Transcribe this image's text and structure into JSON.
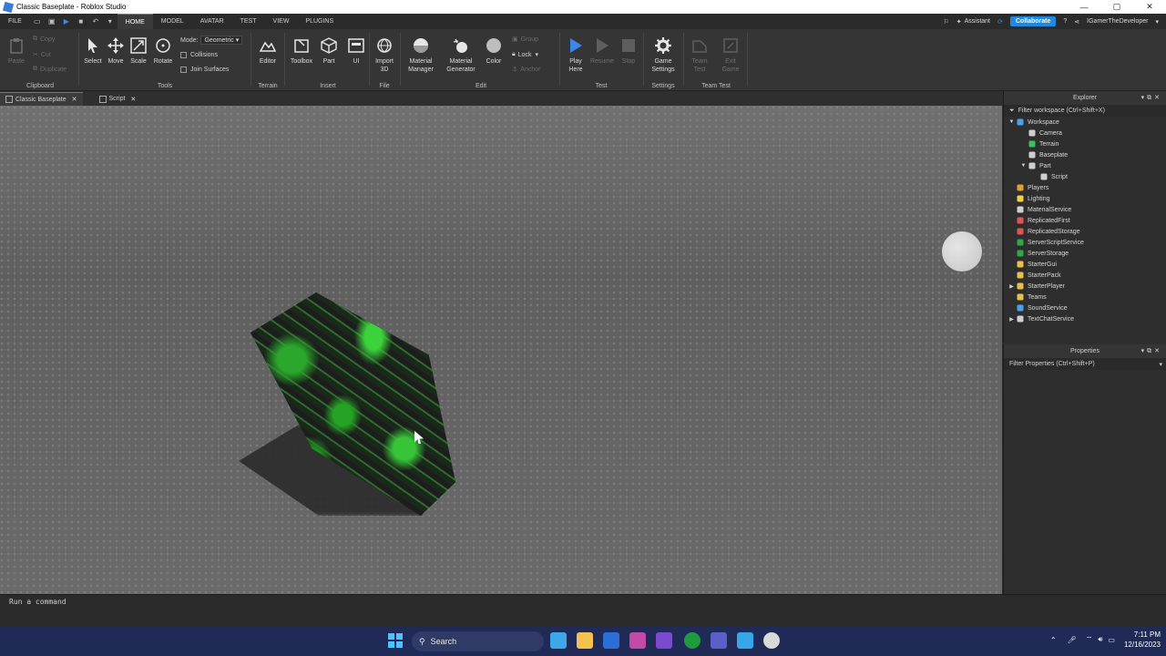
{
  "window": {
    "title": "Classic Baseplate - Roblox Studio"
  },
  "menu": {
    "file": "FILE",
    "tabs": [
      "HOME",
      "MODEL",
      "AVATAR",
      "TEST",
      "VIEW",
      "PLUGINS"
    ],
    "assistant": "Assistant",
    "collaborate": "Collaborate",
    "user": "IGamerTheDeveloper"
  },
  "ribbon": {
    "clipboard": {
      "paste": "Paste",
      "copy": "Copy",
      "cut": "Cut",
      "duplicate": "Duplicate",
      "label": "Clipboard"
    },
    "tools": {
      "select": "Select",
      "move": "Move",
      "scale": "Scale",
      "rotate": "Rotate",
      "mode_label": "Mode:",
      "mode_value": "Geometric",
      "collisions": "Collisions",
      "join_surfaces": "Join Surfaces",
      "label": "Tools"
    },
    "terrain": {
      "editor": "Editor",
      "label": "Terrain"
    },
    "insert": {
      "toolbox": "Toolbox",
      "part": "Part",
      "ui": "UI",
      "label": "Insert"
    },
    "file": {
      "import3d_1": "Import",
      "import3d_2": "3D",
      "label": "File"
    },
    "edit": {
      "material_manager_1": "Material",
      "material_manager_2": "Manager",
      "material_generator_1": "Material",
      "material_generator_2": "Generator",
      "color": "Color",
      "group": "Group",
      "lock": "Lock",
      "anchor": "Anchor",
      "label": "Edit"
    },
    "test": {
      "play_here_1": "Play",
      "play_here_2": "Here",
      "resume": "Resume",
      "stop": "Stop",
      "label": "Test"
    },
    "settings": {
      "game_settings_1": "Game",
      "game_settings_2": "Settings",
      "label": "Settings"
    },
    "team_test": {
      "team_test_1": "Team",
      "team_test_2": "Test",
      "exit_game_1": "Exit",
      "exit_game_2": "Game",
      "label": "Team Test"
    }
  },
  "doc_tabs": [
    "Classic Baseplate",
    "Script"
  ],
  "explorer": {
    "title": "Explorer",
    "filter": "Filter workspace (Ctrl+Shift+X)",
    "items": [
      {
        "label": "Workspace",
        "icon": "globe-icon",
        "indent": 0,
        "arrow": "▼"
      },
      {
        "label": "Camera",
        "icon": "camera-icon",
        "indent": 1,
        "arrow": ""
      },
      {
        "label": "Terrain",
        "icon": "terrain-icon",
        "indent": 1,
        "arrow": ""
      },
      {
        "label": "Baseplate",
        "icon": "part-icon",
        "indent": 1,
        "arrow": ""
      },
      {
        "label": "Part",
        "icon": "part-icon",
        "indent": 1,
        "arrow": "▼"
      },
      {
        "label": "Script",
        "icon": "script-icon",
        "indent": 2,
        "arrow": ""
      },
      {
        "label": "Players",
        "icon": "players-icon",
        "indent": 0,
        "arrow": ""
      },
      {
        "label": "Lighting",
        "icon": "lighting-icon",
        "indent": 0,
        "arrow": ""
      },
      {
        "label": "MaterialService",
        "icon": "material-icon",
        "indent": 0,
        "arrow": ""
      },
      {
        "label": "ReplicatedFirst",
        "icon": "replicated-icon",
        "indent": 0,
        "arrow": ""
      },
      {
        "label": "ReplicatedStorage",
        "icon": "replicated-icon",
        "indent": 0,
        "arrow": ""
      },
      {
        "label": "ServerScriptService",
        "icon": "server-icon",
        "indent": 0,
        "arrow": ""
      },
      {
        "label": "ServerStorage",
        "icon": "server-icon",
        "indent": 0,
        "arrow": ""
      },
      {
        "label": "StarterGui",
        "icon": "folder-icon",
        "indent": 0,
        "arrow": ""
      },
      {
        "label": "StarterPack",
        "icon": "folder-icon",
        "indent": 0,
        "arrow": ""
      },
      {
        "label": "StarterPlayer",
        "icon": "folder-icon",
        "indent": 0,
        "arrow": "▶"
      },
      {
        "label": "Teams",
        "icon": "folder-icon",
        "indent": 0,
        "arrow": ""
      },
      {
        "label": "SoundService",
        "icon": "sound-icon",
        "indent": 0,
        "arrow": ""
      },
      {
        "label": "TextChatService",
        "icon": "chat-icon",
        "indent": 0,
        "arrow": "▶"
      }
    ]
  },
  "properties": {
    "title": "Properties",
    "filter": "Filter Properties (Ctrl+Shift+P)"
  },
  "command_bar": {
    "text": "Run a command"
  },
  "taskbar": {
    "search": "Search",
    "time": "7:11 PM",
    "date": "12/16/2023"
  },
  "colors": {
    "accent": "#1e88e5",
    "ribbon": "#353535",
    "taskbar": "#1f2a56"
  }
}
